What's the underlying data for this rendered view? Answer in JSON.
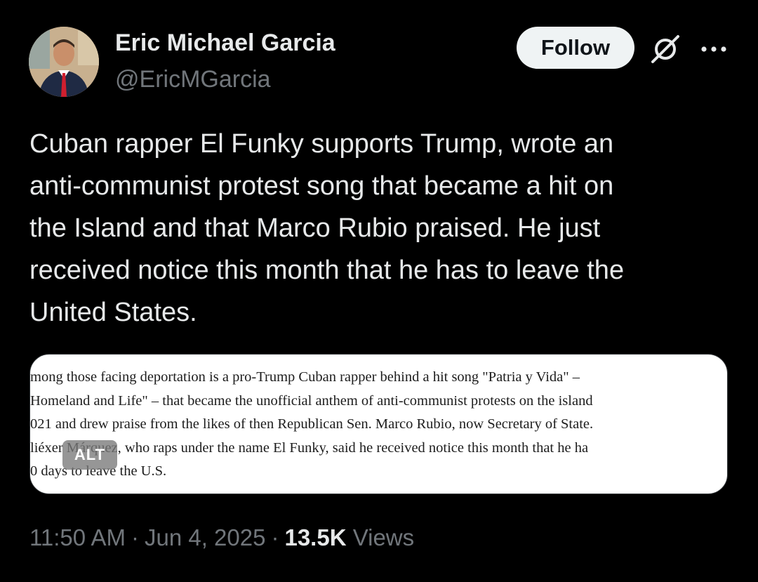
{
  "author": {
    "display_name": "Eric Michael Garcia",
    "handle": "@EricMGarcia",
    "avatar_icon": "profile-photo"
  },
  "actions": {
    "follow_label": "Follow",
    "grok_icon": "grok-icon",
    "more_icon": "more-icon"
  },
  "tweet": {
    "text": "Cuban rapper El Funky supports Trump, wrote an\nanti-communist protest song that became a hit on\nthe Island and that Marco Rubio praised. He just\nreceived notice this month that he has to leave the\nUnited States."
  },
  "media": {
    "alt_label": "ALT",
    "lines": [
      "mong those facing deportation is a pro-Trump Cuban rapper behind a hit song \"Patria y Vida\" –",
      "Homeland and Life\" – that became the unofficial anthem of anti-communist protests on the island",
      "021 and drew praise from the likes of then Republican Sen. Marco Rubio, now Secretary of State.",
      "liéxer Márquez, who raps under the name El Funky, said he received notice this month that he ha",
      "0 days to leave the U.S."
    ]
  },
  "meta": {
    "time": "11:50 AM",
    "separator": "·",
    "date": "Jun 4, 2025",
    "views_count": "13.5K",
    "views_label": "Views"
  },
  "colors": {
    "background": "#000000",
    "primary_text": "#e7e9ea",
    "secondary_text": "#71767b",
    "follow_bg": "#eff3f4"
  }
}
